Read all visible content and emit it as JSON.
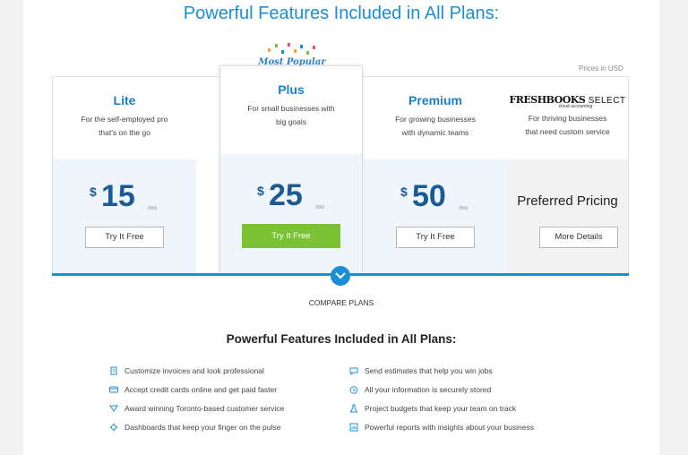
{
  "header": {
    "title": "Powerful Features Included in All Plans:"
  },
  "prices_note": "Prices in USD",
  "most_popular": "Most Popular",
  "plans": [
    {
      "name": "Lite",
      "desc_line1": "For the self-employed pro",
      "desc_line2": "that's on the go",
      "currency": "$",
      "price": "15",
      "per": "/mo",
      "button": "Try It Free"
    },
    {
      "name": "Plus",
      "desc_line1": "For small businesses with",
      "desc_line2": "big goals",
      "currency": "$",
      "price": "25",
      "per": "/mo",
      "button": "Try It Free"
    },
    {
      "name": "Premium",
      "desc_line1": "For growing businesses",
      "desc_line2": "with dynamic teams",
      "currency": "$",
      "price": "50",
      "per": "/mo",
      "button": "Try It Free"
    },
    {
      "brand": "FRESHBOOKS",
      "brand_select": "SELECT",
      "brand_sub": "cloud accounting",
      "desc_line1": "For thriving businesses",
      "desc_line2": "that need custom service",
      "preferred": "Preferred Pricing",
      "button": "More Details"
    }
  ],
  "compare": "COMPARE PLANS",
  "features_title": "Powerful Features Included in All Plans:",
  "features_left": [
    "Customize invoices and look professional",
    "Accept credit cards online and get paid faster",
    "Award winning Toronto-based customer service",
    "Dashboards that keep your finger on the pulse"
  ],
  "features_right": [
    "Send estimates that help you win jobs",
    "All your information is securely stored",
    "Project budgets that keep your team on track",
    "Powerful reports with insights about your business"
  ],
  "colors": {
    "accent": "#1a8fd8",
    "price": "#1b5a96",
    "cta": "#7ac232"
  }
}
